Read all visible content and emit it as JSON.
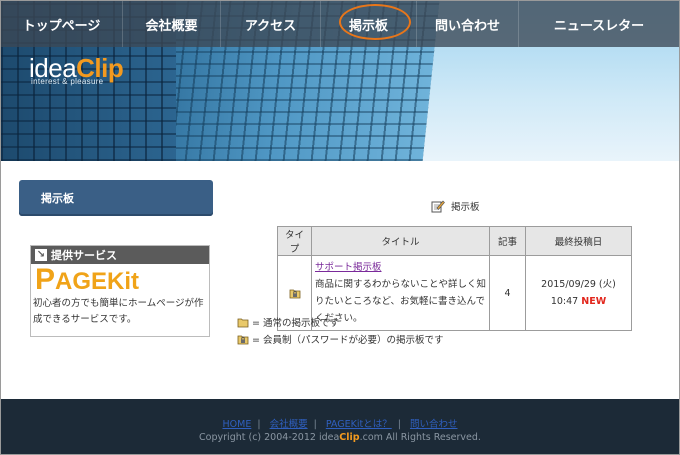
{
  "nav": {
    "items": [
      "トップページ",
      "会社概要",
      "アクセス",
      "掲示板",
      "問い合わせ",
      "ニュースレター"
    ],
    "active_index": 3,
    "highlight_color": "#e8761a"
  },
  "logo": {
    "part1": "idea",
    "part2": "Clip",
    "sub": "interest & pleasure"
  },
  "sidebar": {
    "menu_label": "掲示板",
    "service_heading": "提供サービス",
    "service_logo_first": "P",
    "service_logo_rest": "AGEKit",
    "service_desc_line1": "初心者の方でも簡単にホームページが作",
    "service_desc_line2": "成できるサービスです。"
  },
  "main": {
    "page_heading": "掲示板",
    "table": {
      "headers": [
        "タイプ",
        "タイトル",
        "記事",
        "最終投稿日"
      ],
      "rows": [
        {
          "type_icon": "lock-folder-icon",
          "title": "サポート掲示板",
          "description": "商品に関するわからないことや詳しく知りたいところなど、お気軽に書き込んでください。",
          "count": "4",
          "date": "2015/09/29 (火)",
          "time": "10:47",
          "badge": "NEW"
        }
      ]
    },
    "legend": {
      "normal": "= 通常の掲示板です",
      "member": "= 会員制（パスワードが必要）の掲示板です"
    }
  },
  "footer": {
    "links": [
      "HOME",
      "会社概要",
      "PAGEKitとは？",
      "問い合わせ"
    ],
    "copyright_prefix": "Copyright (c) 2004-2012 idea",
    "copyright_clip": "Clip",
    "copyright_suffix": ".com All Rights Reserved."
  },
  "colors": {
    "accent_orange": "#f39a1f",
    "sidebar_button": "#3a5f86",
    "footer_bg": "#1c2a37",
    "new_badge": "#e2261c"
  }
}
